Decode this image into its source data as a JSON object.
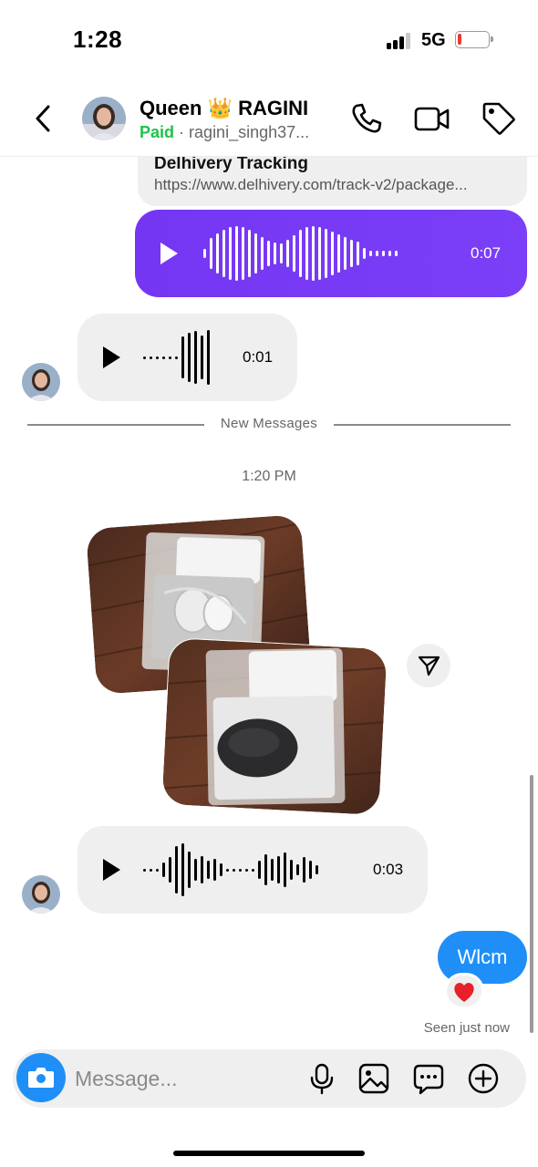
{
  "status_bar": {
    "time": "1:28",
    "network": "5G",
    "battery_level": 0.12,
    "battery_color": "#eb3b2e"
  },
  "header": {
    "name": "Queen 👑 RAGINI",
    "badge": "Paid",
    "separator": "·",
    "username": "ragini_singh37..."
  },
  "thread": {
    "link_card": {
      "title": "Delhivery Tracking",
      "url": "https://www.delhivery.com/track-v2/package..."
    },
    "voice_outgoing": {
      "duration": "0:07",
      "color": "#7b3ff7"
    },
    "voice_incoming_1": {
      "duration": "0:01"
    },
    "new_messages_label": "New Messages",
    "timestamp": "1:20 PM",
    "voice_incoming_2": {
      "duration": "0:03"
    },
    "outgoing_text": "Wlcm",
    "outgoing_color": "#1f8ff7",
    "reaction": "❤️",
    "seen_status": "Seen just now"
  },
  "composer": {
    "placeholder": "Message..."
  },
  "icons": {
    "back": "chevron-left-icon",
    "call": "phone-icon",
    "video": "video-camera-icon",
    "tag": "tag-icon",
    "camera": "camera-icon",
    "mic": "microphone-icon",
    "gallery": "image-icon",
    "sticker": "sticker-icon",
    "plus": "plus-circle-icon",
    "share": "send-icon",
    "play": "play-icon"
  }
}
